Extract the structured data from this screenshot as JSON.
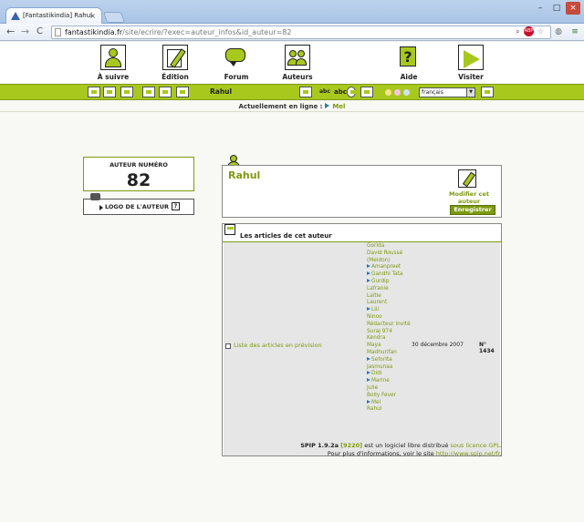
{
  "browser": {
    "tab_title": "[Fantastikindia] Rahul",
    "tab_close": "×",
    "url_host": "fantastikindia.fr",
    "url_path": "/site/ecrire/?exec=auteur_infos&id_auteur=82",
    "window_controls": {
      "minimize": "–",
      "maximize": "□",
      "close": "×"
    },
    "nav": {
      "back": "←",
      "forward": "→",
      "reload": "C"
    }
  },
  "menu": {
    "items": [
      {
        "label": "À suivre",
        "icon": "person-icon"
      },
      {
        "label": "Édition",
        "icon": "edit-pen-icon"
      },
      {
        "label": "Forum",
        "icon": "speech-bubble-icon"
      },
      {
        "label": "Auteurs",
        "icon": "authors-group-icon"
      },
      {
        "label": "Aide",
        "icon": "help-icon"
      },
      {
        "label": "Visiter",
        "icon": "visit-arrow-icon"
      }
    ]
  },
  "toolbar": {
    "user": "Rahul",
    "abc1": "abc",
    "abc2": "abc",
    "language": "français",
    "accent_color": "#a8c81e"
  },
  "online": {
    "label": "Actuellement en ligne :",
    "user": "Mel"
  },
  "author_box": {
    "title": "AUTEUR NUMÉRO",
    "number": "82"
  },
  "logo_box": {
    "label": "LOGO DE L'AUTEUR",
    "help": "?"
  },
  "author_card": {
    "name": "Rahul",
    "modify_label": "Modifier cet auteur",
    "save_label": "Enregistrer"
  },
  "articles": {
    "title": "Les articles de cet auteur",
    "row": {
      "link": "Liste des articles en prévision",
      "date": "30 décembre 2007",
      "number": "N° 1434",
      "authors": [
        {
          "name": "Gorida",
          "online": false
        },
        {
          "name": "David Roussé",
          "online": false
        },
        {
          "name": "(Meldon)",
          "online": false
        },
        {
          "name": "Amanpreet",
          "online": true
        },
        {
          "name": "Gandhi Tata",
          "online": true
        },
        {
          "name": "Gurdip",
          "online": true
        },
        {
          "name": "Lafranie",
          "online": false
        },
        {
          "name": "Laïtie",
          "online": false
        },
        {
          "name": "Laurent",
          "online": false
        },
        {
          "name": "Lili",
          "online": true
        },
        {
          "name": "Ninoo",
          "online": false
        },
        {
          "name": "Rédacteur invité",
          "online": false
        },
        {
          "name": "Suraj 974",
          "online": false
        },
        {
          "name": "Kendra",
          "online": false
        },
        {
          "name": "Maya",
          "online": false
        },
        {
          "name": "Madhurifan",
          "online": false
        },
        {
          "name": "Seforita",
          "online": true
        },
        {
          "name": "Jasmunaa",
          "online": false
        },
        {
          "name": "Didi",
          "online": true
        },
        {
          "name": "Marine",
          "online": true
        },
        {
          "name": "Julie",
          "online": false
        },
        {
          "name": "Bolly Fever",
          "online": false
        },
        {
          "name": "Mel",
          "online": true
        },
        {
          "name": "Rahul",
          "online": false
        }
      ]
    }
  },
  "footer": {
    "product": "SPIP 1.9.2a",
    "revision": "[9220]",
    "text1": " est un logiciel libre distribué ",
    "license": "sous licence GPL",
    "text2": "Pour plus d'informations, voir le site ",
    "site": "http://www.spip.net/fr"
  }
}
